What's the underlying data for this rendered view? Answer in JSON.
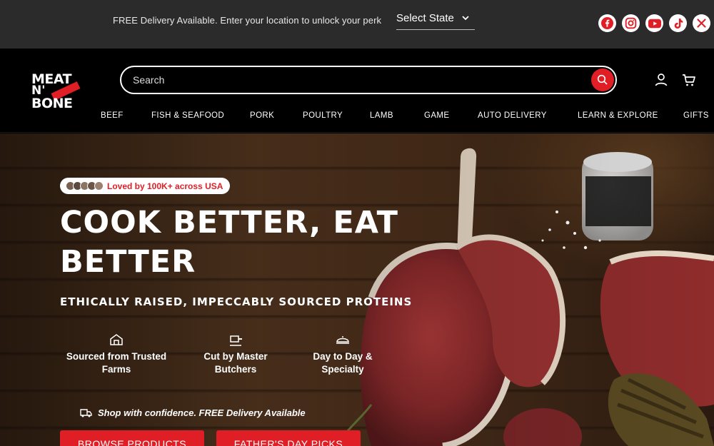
{
  "topbar": {
    "promo": "FREE Delivery Available. Enter your location to unlock your perk",
    "state_select": "Select State",
    "socials": [
      "facebook-icon",
      "instagram-icon",
      "youtube-icon",
      "tiktok-icon",
      "x-icon"
    ]
  },
  "header": {
    "logo": {
      "line1": "MEAT",
      "line2": "N'",
      "line3": "BONE"
    },
    "search_placeholder": "Search",
    "icons": [
      "user-icon",
      "cart-icon"
    ]
  },
  "nav": [
    "BEEF",
    "FISH & SEAFOOD",
    "PORK",
    "POULTRY",
    "LAMB",
    "GAME",
    "AUTO DELIVERY",
    "LEARN & EXPLORE",
    "GIFTS"
  ],
  "hero": {
    "badge": "Loved by 100K+ across USA",
    "title": "COOK BETTER, EAT BETTER",
    "subtitle": "ETHICALLY RAISED, IMPECCABLY SOURCED PROTEINS",
    "features": [
      {
        "label": "Sourced from Trusted Farms",
        "icon": "farm-icon"
      },
      {
        "label": "Cut by Master Butchers",
        "icon": "cleaver-icon"
      },
      {
        "label": "Day to Day & Specialty",
        "icon": "dish-icon"
      }
    ],
    "confidence": "Shop with confidence. FREE Delivery Available",
    "buttons": [
      "BROWSE PRODUCTS",
      "FATHER'S DAY PICKS"
    ]
  },
  "colors": {
    "accent": "#e01e25",
    "topbar_bg": "#2b2b2b",
    "header_bg": "#000000"
  }
}
